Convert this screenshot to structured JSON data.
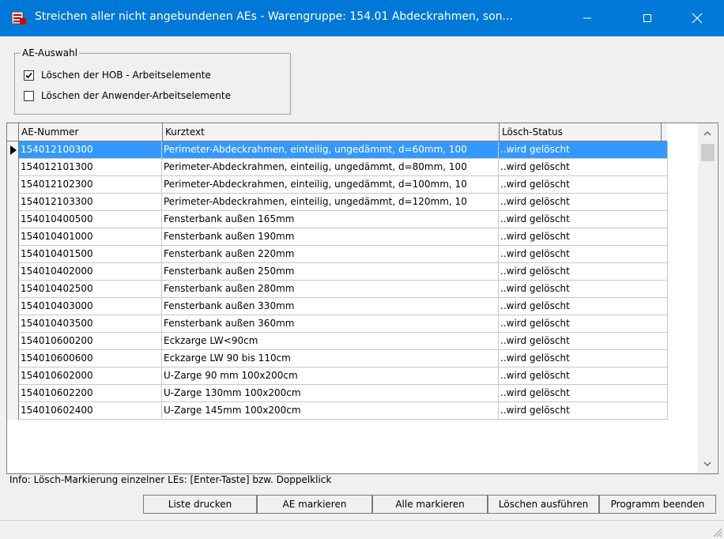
{
  "window": {
    "title": "Streichen aller nicht angebundenen AEs - Warengruppe: 154.01  Abdeckrahmen, son...",
    "accent": "#0078d7"
  },
  "ae_auswahl": {
    "label": "AE-Auswahl",
    "options": [
      {
        "label": "Löschen der HOB - Arbeitselemente",
        "checked": true
      },
      {
        "label": "Löschen der Anwender-Arbeitselemente",
        "checked": false
      }
    ]
  },
  "grid": {
    "columns": [
      "AE-Nummer",
      "Kurztext",
      "Lösch-Status"
    ],
    "selected_color": "#3399ff",
    "rows": [
      {
        "nummer": "154012100300",
        "kurztext": "Perimeter-Abdeckrahmen, einteilig, ungedämmt, d=60mm, 100",
        "status": "..wird gelöscht"
      },
      {
        "nummer": "154012101300",
        "kurztext": "Perimeter-Abdeckrahmen, einteilig, ungedämmt, d=80mm, 100",
        "status": "..wird gelöscht"
      },
      {
        "nummer": "154012102300",
        "kurztext": "Perimeter-Abdeckrahmen, einteilig, ungedämmt, d=100mm, 10",
        "status": "..wird gelöscht"
      },
      {
        "nummer": "154012103300",
        "kurztext": "Perimeter-Abdeckrahmen, einteilig, ungedämmt, d=120mm, 10",
        "status": "..wird gelöscht"
      },
      {
        "nummer": "154010400500",
        "kurztext": "Fensterbank außen 165mm",
        "status": "..wird gelöscht"
      },
      {
        "nummer": "154010401000",
        "kurztext": "Fensterbank außen 190mm",
        "status": "..wird gelöscht"
      },
      {
        "nummer": "154010401500",
        "kurztext": "Fensterbank außen 220mm",
        "status": "..wird gelöscht"
      },
      {
        "nummer": "154010402000",
        "kurztext": "Fensterbank außen 250mm",
        "status": "..wird gelöscht"
      },
      {
        "nummer": "154010402500",
        "kurztext": "Fensterbank außen 280mm",
        "status": "..wird gelöscht"
      },
      {
        "nummer": "154010403000",
        "kurztext": "Fensterbank außen 330mm",
        "status": "..wird gelöscht"
      },
      {
        "nummer": "154010403500",
        "kurztext": "Fensterbank außen 360mm",
        "status": "..wird gelöscht"
      },
      {
        "nummer": "154010600200",
        "kurztext": "Eckzarge LW<90cm",
        "status": "..wird gelöscht"
      },
      {
        "nummer": "154010600600",
        "kurztext": "Eckzarge LW 90 bis 110cm",
        "status": "..wird gelöscht"
      },
      {
        "nummer": "154010602000",
        "kurztext": "U-Zarge 90 mm 100x200cm",
        "status": "..wird gelöscht"
      },
      {
        "nummer": "154010602200",
        "kurztext": "U-Zarge 130mm 100x200cm",
        "status": "..wird gelöscht"
      },
      {
        "nummer": "154010602400",
        "kurztext": "U-Zarge 145mm 100x200cm",
        "status": "..wird gelöscht"
      }
    ]
  },
  "info": "Info:  Lösch-Markierung einzelner LEs: [Enter-Taste] bzw. Doppelklick",
  "buttons": {
    "print": "Liste drucken",
    "mark": "AE markieren",
    "mark_all": "Alle markieren",
    "delete": "Löschen ausführen",
    "exit": "Programm beenden"
  }
}
